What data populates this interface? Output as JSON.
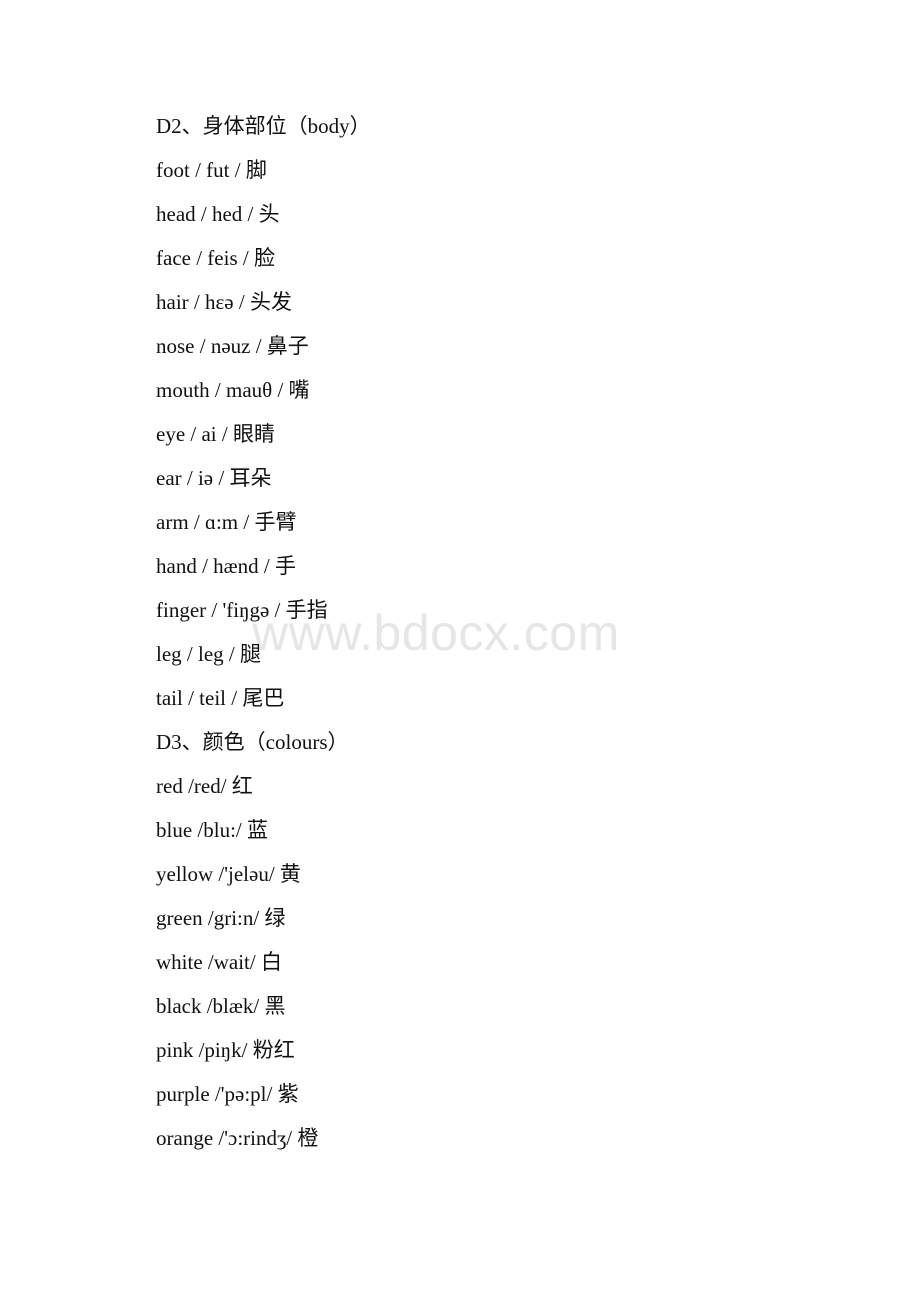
{
  "document": {
    "watermark": "www.bdocx.com",
    "sections": [
      {
        "heading": "D2、身体部位（body）",
        "entries": [
          "foot / fut / 脚",
          "head / hed / 头",
          "face / feis / 脸",
          "hair / hɛə / 头发",
          "nose / nəuz / 鼻子",
          "mouth / mauθ / 嘴",
          "eye / ai / 眼睛",
          "ear / iə / 耳朵",
          "arm / ɑ:m / 手臂",
          "hand / hænd / 手",
          "finger / 'fiŋgə / 手指",
          "leg / leg / 腿",
          "tail / teil / 尾巴"
        ]
      },
      {
        "heading": "D3、颜色（colours）",
        "entries": [
          "red /red/ 红",
          "blue /blu:/ 蓝",
          "yellow /'jeləu/ 黄",
          "green /gri:n/ 绿",
          "white /wait/ 白",
          "black /blæk/ 黑",
          "pink /piŋk/ 粉红",
          "purple /'pə:pl/ 紫",
          "orange /'ɔ:rindʒ/ 橙"
        ]
      }
    ]
  }
}
